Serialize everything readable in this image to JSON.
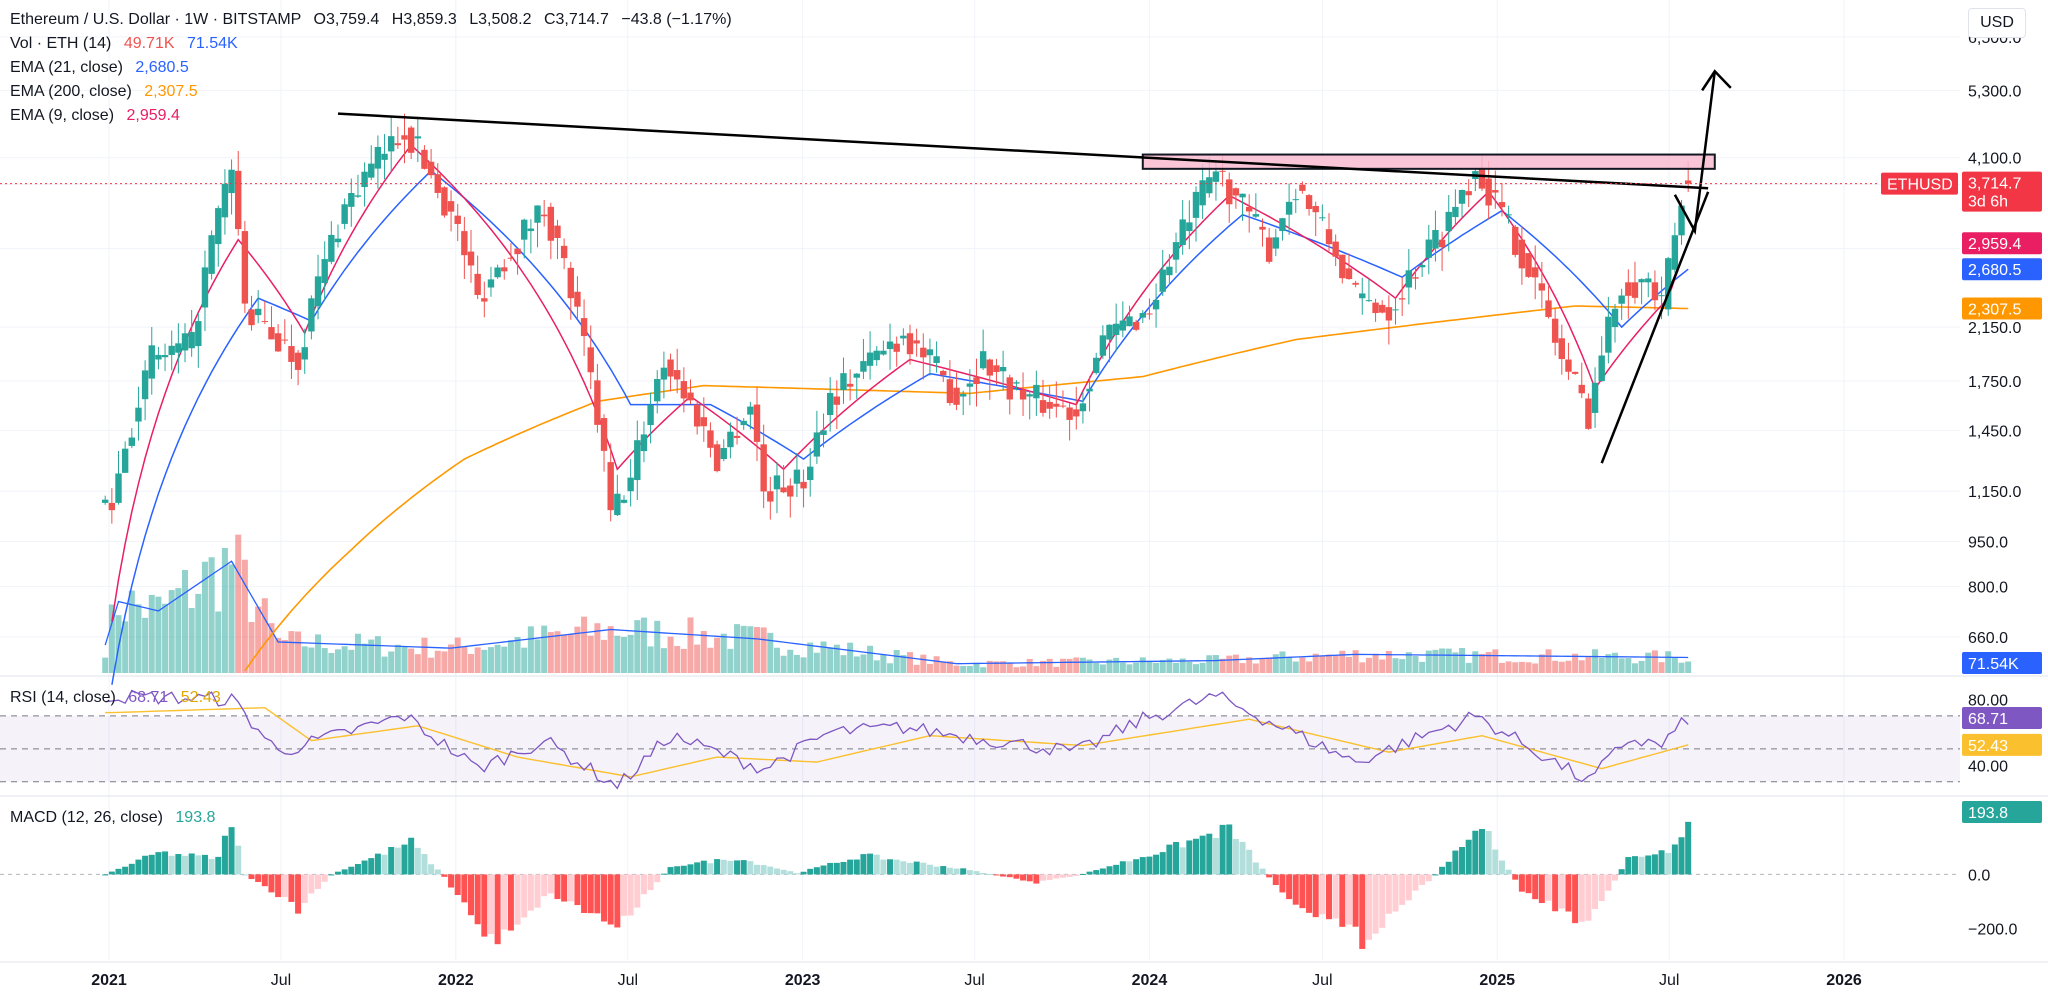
{
  "header": {
    "symbol_title": "Ethereum / U.S. Dollar · 1W · BITSTAMP",
    "ohlc": [
      {
        "k": "O",
        "v": "3,759.4"
      },
      {
        "k": "H",
        "v": "3,859.3"
      },
      {
        "k": "L",
        "v": "3,508.2"
      },
      {
        "k": "C",
        "v": "3,714.7"
      }
    ],
    "change": "−43.8 (−1.17%)",
    "currency_button": "USD"
  },
  "legends": {
    "volume": {
      "label": "Vol · ETH (14)",
      "values": [
        "49.71K",
        "71.54K"
      ],
      "colors": [
        "#ef5350",
        "#2962ff"
      ]
    },
    "ema21": {
      "label": "EMA (21, close)",
      "value": "2,680.5",
      "color": "#2962ff"
    },
    "ema200": {
      "label": "EMA (200, close)",
      "value": "2,307.5",
      "color": "#ff9800"
    },
    "ema9": {
      "label": "EMA (9, close)",
      "value": "2,959.4",
      "color": "#e91e63"
    },
    "rsi": {
      "label": "RSI (14, close)",
      "values": [
        "68.71",
        "52.43"
      ],
      "colors": [
        "#7e57c2",
        "#fbc02d"
      ]
    },
    "macd": {
      "label": "MACD (12, 26, close)",
      "value": "193.8",
      "color": "#26a69a"
    }
  },
  "colors": {
    "up": "#26a69a",
    "down": "#ef5350",
    "ema9": "#e91e63",
    "ema21": "#2962ff",
    "ema200": "#ff9800",
    "rsi": "#7e57c2",
    "rsi_ma": "#fbc02d",
    "resistance_zone": "#f8bbd0",
    "price_line": "#f23645"
  },
  "chart_data": [
    {
      "type": "candlestick",
      "title": "Ethereum / U.S. Dollar · 1W · BITSTAMP",
      "scale": "log",
      "x_ticks": [
        "2021",
        "Jul",
        "2022",
        "Jul",
        "2023",
        "Jul",
        "2024",
        "Jul",
        "2025",
        "Jul",
        "2026"
      ],
      "y_ticks": [
        6500,
        5300,
        4100,
        3700,
        2900,
        2150,
        1750,
        1450,
        1150,
        950,
        800,
        660
      ],
      "y_tick_labels": [
        "6,500.0",
        "5,300.0",
        "4,100.0",
        "",
        "",
        "2,150.0",
        "1,750.0",
        "1,450.0",
        "1,150.0",
        "950.0",
        "800.0",
        "660.0"
      ],
      "ylim": [
        560,
        7200
      ],
      "price_anchors": [
        {
          "date": "2021-01-04",
          "close": 1100
        },
        {
          "date": "2021-02-15",
          "close": 1900
        },
        {
          "date": "2021-03-29",
          "close": 2000
        },
        {
          "date": "2021-05-10",
          "close": 3900
        },
        {
          "date": "2021-05-24",
          "close": 2300
        },
        {
          "date": "2021-07-19",
          "close": 1900
        },
        {
          "date": "2021-09-06",
          "close": 3400
        },
        {
          "date": "2021-11-08",
          "close": 4600
        },
        {
          "date": "2022-01-03",
          "close": 3100
        },
        {
          "date": "2022-01-24",
          "close": 2400
        },
        {
          "date": "2022-04-04",
          "close": 3400
        },
        {
          "date": "2022-06-13",
          "close": 1050
        },
        {
          "date": "2022-07-04",
          "close": 1200
        },
        {
          "date": "2022-08-08",
          "close": 1900
        },
        {
          "date": "2022-10-03",
          "close": 1300
        },
        {
          "date": "2022-11-07",
          "close": 1600
        },
        {
          "date": "2022-11-21",
          "close": 1150
        },
        {
          "date": "2023-01-02",
          "close": 1200
        },
        {
          "date": "2023-01-30",
          "close": 1650
        },
        {
          "date": "2023-04-17",
          "close": 2100
        },
        {
          "date": "2023-06-12",
          "close": 1650
        },
        {
          "date": "2023-07-10",
          "close": 1900
        },
        {
          "date": "2023-08-21",
          "close": 1650
        },
        {
          "date": "2023-10-16",
          "close": 1560
        },
        {
          "date": "2023-11-13",
          "close": 2050
        },
        {
          "date": "2024-01-01",
          "close": 2300
        },
        {
          "date": "2024-03-11",
          "close": 3900
        },
        {
          "date": "2024-05-06",
          "close": 2900
        },
        {
          "date": "2024-06-03",
          "close": 3700
        },
        {
          "date": "2024-08-05",
          "close": 2400
        },
        {
          "date": "2024-09-09",
          "close": 2300
        },
        {
          "date": "2024-11-04",
          "close": 3100
        },
        {
          "date": "2024-12-09",
          "close": 3950
        },
        {
          "date": "2025-01-06",
          "close": 3300
        },
        {
          "date": "2025-02-03",
          "close": 2700
        },
        {
          "date": "2025-03-10",
          "close": 1900
        },
        {
          "date": "2025-04-07",
          "close": 1550
        },
        {
          "date": "2025-05-12",
          "close": 2550
        },
        {
          "date": "2025-06-09",
          "close": 2550
        },
        {
          "date": "2025-06-23",
          "close": 2300
        },
        {
          "date": "2025-07-07",
          "close": 3050
        },
        {
          "date": "2025-07-21",
          "close": 3714.7
        }
      ],
      "ema_anchors": {
        "ema9": [
          {
            "date": "2021-01-04",
            "v": 700
          },
          {
            "date": "2021-05-17",
            "v": 3000
          },
          {
            "date": "2021-07-26",
            "v": 2100
          },
          {
            "date": "2021-11-15",
            "v": 4300
          },
          {
            "date": "2022-06-20",
            "v": 1250
          },
          {
            "date": "2022-09-05",
            "v": 1650
          },
          {
            "date": "2022-12-12",
            "v": 1250
          },
          {
            "date": "2023-04-24",
            "v": 1900
          },
          {
            "date": "2023-10-16",
            "v": 1600
          },
          {
            "date": "2024-03-25",
            "v": 3550
          },
          {
            "date": "2024-09-16",
            "v": 2400
          },
          {
            "date": "2024-12-23",
            "v": 3600
          },
          {
            "date": "2025-04-14",
            "v": 1700
          },
          {
            "date": "2025-06-30",
            "v": 2400
          },
          {
            "date": "2025-07-21",
            "v": 2959.4
          }
        ],
        "ema21": [
          {
            "date": "2021-01-04",
            "v": 550
          },
          {
            "date": "2021-06-07",
            "v": 2400
          },
          {
            "date": "2021-08-02",
            "v": 2200
          },
          {
            "date": "2021-12-06",
            "v": 3900
          },
          {
            "date": "2022-07-04",
            "v": 1600
          },
          {
            "date": "2022-09-26",
            "v": 1600
          },
          {
            "date": "2023-01-02",
            "v": 1300
          },
          {
            "date": "2023-05-15",
            "v": 1800
          },
          {
            "date": "2023-10-23",
            "v": 1620
          },
          {
            "date": "2024-04-08",
            "v": 3300
          },
          {
            "date": "2024-09-23",
            "v": 2600
          },
          {
            "date": "2025-01-06",
            "v": 3350
          },
          {
            "date": "2025-05-12",
            "v": 2150
          },
          {
            "date": "2025-07-21",
            "v": 2680.5
          }
        ],
        "ema200": [
          {
            "date": "2021-05-24",
            "v": 580
          },
          {
            "date": "2021-09-13",
            "v": 920
          },
          {
            "date": "2022-01-10",
            "v": 1300
          },
          {
            "date": "2022-05-30",
            "v": 1620
          },
          {
            "date": "2022-09-19",
            "v": 1720
          },
          {
            "date": "2023-06-26",
            "v": 1670
          },
          {
            "date": "2023-12-25",
            "v": 1780
          },
          {
            "date": "2024-06-03",
            "v": 2050
          },
          {
            "date": "2024-12-30",
            "v": 2250
          },
          {
            "date": "2025-03-24",
            "v": 2330
          },
          {
            "date": "2025-07-21",
            "v": 2307.5
          }
        ]
      },
      "last_price": {
        "symbol": "ETHUSD",
        "value": "3,714.7",
        "countdown": "3d 6h"
      },
      "ema_last_labels": [
        {
          "value": "2,959.4",
          "color": "#e91e63"
        },
        {
          "value": "2,680.5",
          "color": "#2962ff"
        },
        {
          "value": "2,307.5",
          "color": "#ff9800"
        }
      ],
      "annotations": [
        "descending trendline from 2021 high",
        "resistance zone ~3,950–4,150",
        "ascending trendline from 2025 low",
        "projected breakout arrow"
      ]
    },
    {
      "type": "bar",
      "title": "Vol · ETH (14)",
      "last_value": "71.54K",
      "volume_anchors": [
        {
          "date": "2020-12-28",
          "v": 0.9
        },
        {
          "date": "2021-01-11",
          "v": 2.3
        },
        {
          "date": "2021-02-22",
          "v": 2.0
        },
        {
          "date": "2021-05-10",
          "v": 3.6
        },
        {
          "date": "2021-06-28",
          "v": 1.0
        },
        {
          "date": "2021-12-27",
          "v": 0.8
        },
        {
          "date": "2022-06-13",
          "v": 1.4
        },
        {
          "date": "2022-11-14",
          "v": 1.1
        },
        {
          "date": "2023-06-12",
          "v": 0.3
        },
        {
          "date": "2024-03-11",
          "v": 0.4
        },
        {
          "date": "2024-08-05",
          "v": 0.6
        },
        {
          "date": "2025-02-03",
          "v": 0.55
        },
        {
          "date": "2025-07-21",
          "v": 0.5
        }
      ]
    },
    {
      "type": "line",
      "title": "RSI (14, close)",
      "ylim": [
        25,
        90
      ],
      "y_tick_labels": [
        "80.00",
        "40.00"
      ],
      "levels": [
        70,
        50,
        30
      ],
      "rsi_anchors": [
        {
          "date": "2021-01-04",
          "v": 82
        },
        {
          "date": "2021-05-10",
          "v": 80
        },
        {
          "date": "2021-06-28",
          "v": 48
        },
        {
          "date": "2021-11-08",
          "v": 70
        },
        {
          "date": "2022-01-24",
          "v": 38
        },
        {
          "date": "2022-04-04",
          "v": 55
        },
        {
          "date": "2022-06-20",
          "v": 27
        },
        {
          "date": "2022-08-15",
          "v": 58
        },
        {
          "date": "2022-11-21",
          "v": 38
        },
        {
          "date": "2023-01-30",
          "v": 60
        },
        {
          "date": "2023-04-17",
          "v": 63
        },
        {
          "date": "2023-10-16",
          "v": 48
        },
        {
          "date": "2023-12-25",
          "v": 68
        },
        {
          "date": "2024-03-11",
          "v": 82
        },
        {
          "date": "2024-08-05",
          "v": 42
        },
        {
          "date": "2024-12-09",
          "v": 70
        },
        {
          "date": "2025-04-07",
          "v": 30
        },
        {
          "date": "2025-05-19",
          "v": 56
        },
        {
          "date": "2025-06-23",
          "v": 52
        },
        {
          "date": "2025-07-21",
          "v": 68.71
        }
      ],
      "rsi_ma_anchors": [
        {
          "date": "2021-01-04",
          "v": 72
        },
        {
          "date": "2021-06-14",
          "v": 75
        },
        {
          "date": "2021-08-02",
          "v": 55
        },
        {
          "date": "2021-11-22",
          "v": 64
        },
        {
          "date": "2022-03-07",
          "v": 45
        },
        {
          "date": "2022-07-04",
          "v": 33
        },
        {
          "date": "2022-10-03",
          "v": 45
        },
        {
          "date": "2023-01-16",
          "v": 42
        },
        {
          "date": "2023-05-15",
          "v": 58
        },
        {
          "date": "2023-10-23",
          "v": 52
        },
        {
          "date": "2024-04-15",
          "v": 68
        },
        {
          "date": "2024-09-09",
          "v": 48
        },
        {
          "date": "2024-12-16",
          "v": 58
        },
        {
          "date": "2025-04-21",
          "v": 38
        },
        {
          "date": "2025-07-21",
          "v": 52.43
        }
      ],
      "last_values": [
        "68.71",
        "52.43"
      ]
    },
    {
      "type": "bar",
      "title": "MACD (12, 26, close)",
      "ylim": [
        -260,
        230
      ],
      "y_tick_labels": [
        "0.0",
        "−200.0"
      ],
      "y_tick_values": [
        0,
        -200
      ],
      "last_value": "193.8",
      "macd_anchors": [
        {
          "date": "2020-12-28",
          "v": 0
        },
        {
          "date": "2021-02-22",
          "v": 80
        },
        {
          "date": "2021-04-26",
          "v": 60
        },
        {
          "date": "2021-05-10",
          "v": 200
        },
        {
          "date": "2021-05-24",
          "v": 0
        },
        {
          "date": "2021-07-19",
          "v": -130
        },
        {
          "date": "2021-08-23",
          "v": 0
        },
        {
          "date": "2021-11-15",
          "v": 120
        },
        {
          "date": "2021-12-20",
          "v": -10
        },
        {
          "date": "2022-02-07",
          "v": -250
        },
        {
          "date": "2022-04-11",
          "v": -70
        },
        {
          "date": "2022-06-20",
          "v": -190
        },
        {
          "date": "2022-08-15",
          "v": 30
        },
        {
          "date": "2022-10-24",
          "v": 60
        },
        {
          "date": "2022-12-26",
          "v": 5
        },
        {
          "date": "2023-03-06",
          "v": 70
        },
        {
          "date": "2023-06-19",
          "v": 20
        },
        {
          "date": "2023-09-04",
          "v": -30
        },
        {
          "date": "2023-10-16",
          "v": -5
        },
        {
          "date": "2024-01-08",
          "v": 80
        },
        {
          "date": "2024-03-25",
          "v": 170
        },
        {
          "date": "2024-05-20",
          "v": -70
        },
        {
          "date": "2024-08-12",
          "v": -240
        },
        {
          "date": "2024-10-28",
          "v": 0
        },
        {
          "date": "2024-12-16",
          "v": 180
        },
        {
          "date": "2025-01-27",
          "v": -60
        },
        {
          "date": "2025-04-07",
          "v": -190
        },
        {
          "date": "2025-05-19",
          "v": 60
        },
        {
          "date": "2025-06-30",
          "v": 90
        },
        {
          "date": "2025-07-21",
          "v": 193.8
        }
      ]
    }
  ]
}
